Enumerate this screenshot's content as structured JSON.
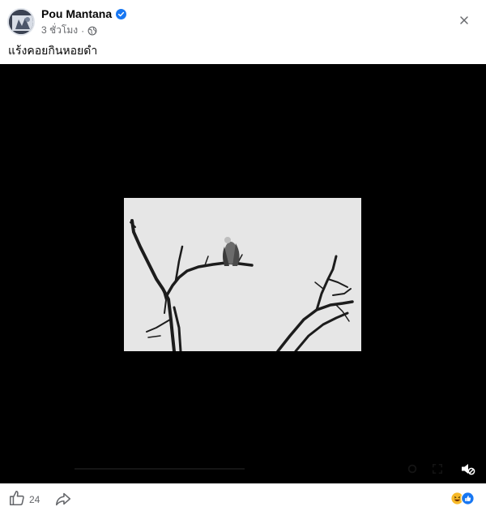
{
  "post": {
    "author_name": "Pou Mantana",
    "timestamp": "3 ชั่วโมง",
    "separator": "·",
    "audience_icon": "globe-icon",
    "verified_icon": "verified-badge-icon",
    "more_icon": "more-options-icon",
    "caption": "แร้งคอยกินหอยดำ"
  },
  "video": {
    "image_subject": "black-and-white vulture perched on bare tree branches",
    "sound_icon": "muted-speaker-icon",
    "settings_icon": "gear-icon",
    "fullscreen_icon": "fullscreen-icon"
  },
  "footer": {
    "like_icon": "thumbs-up-icon",
    "like_count": "24",
    "share_icon": "share-icon",
    "reactions": [
      "haha-reaction",
      "like-reaction"
    ]
  },
  "colors": {
    "verified": "#1877f2",
    "muted_text": "#65676b",
    "like_reaction": "#1877f2",
    "haha_reaction": "#f7b928"
  }
}
